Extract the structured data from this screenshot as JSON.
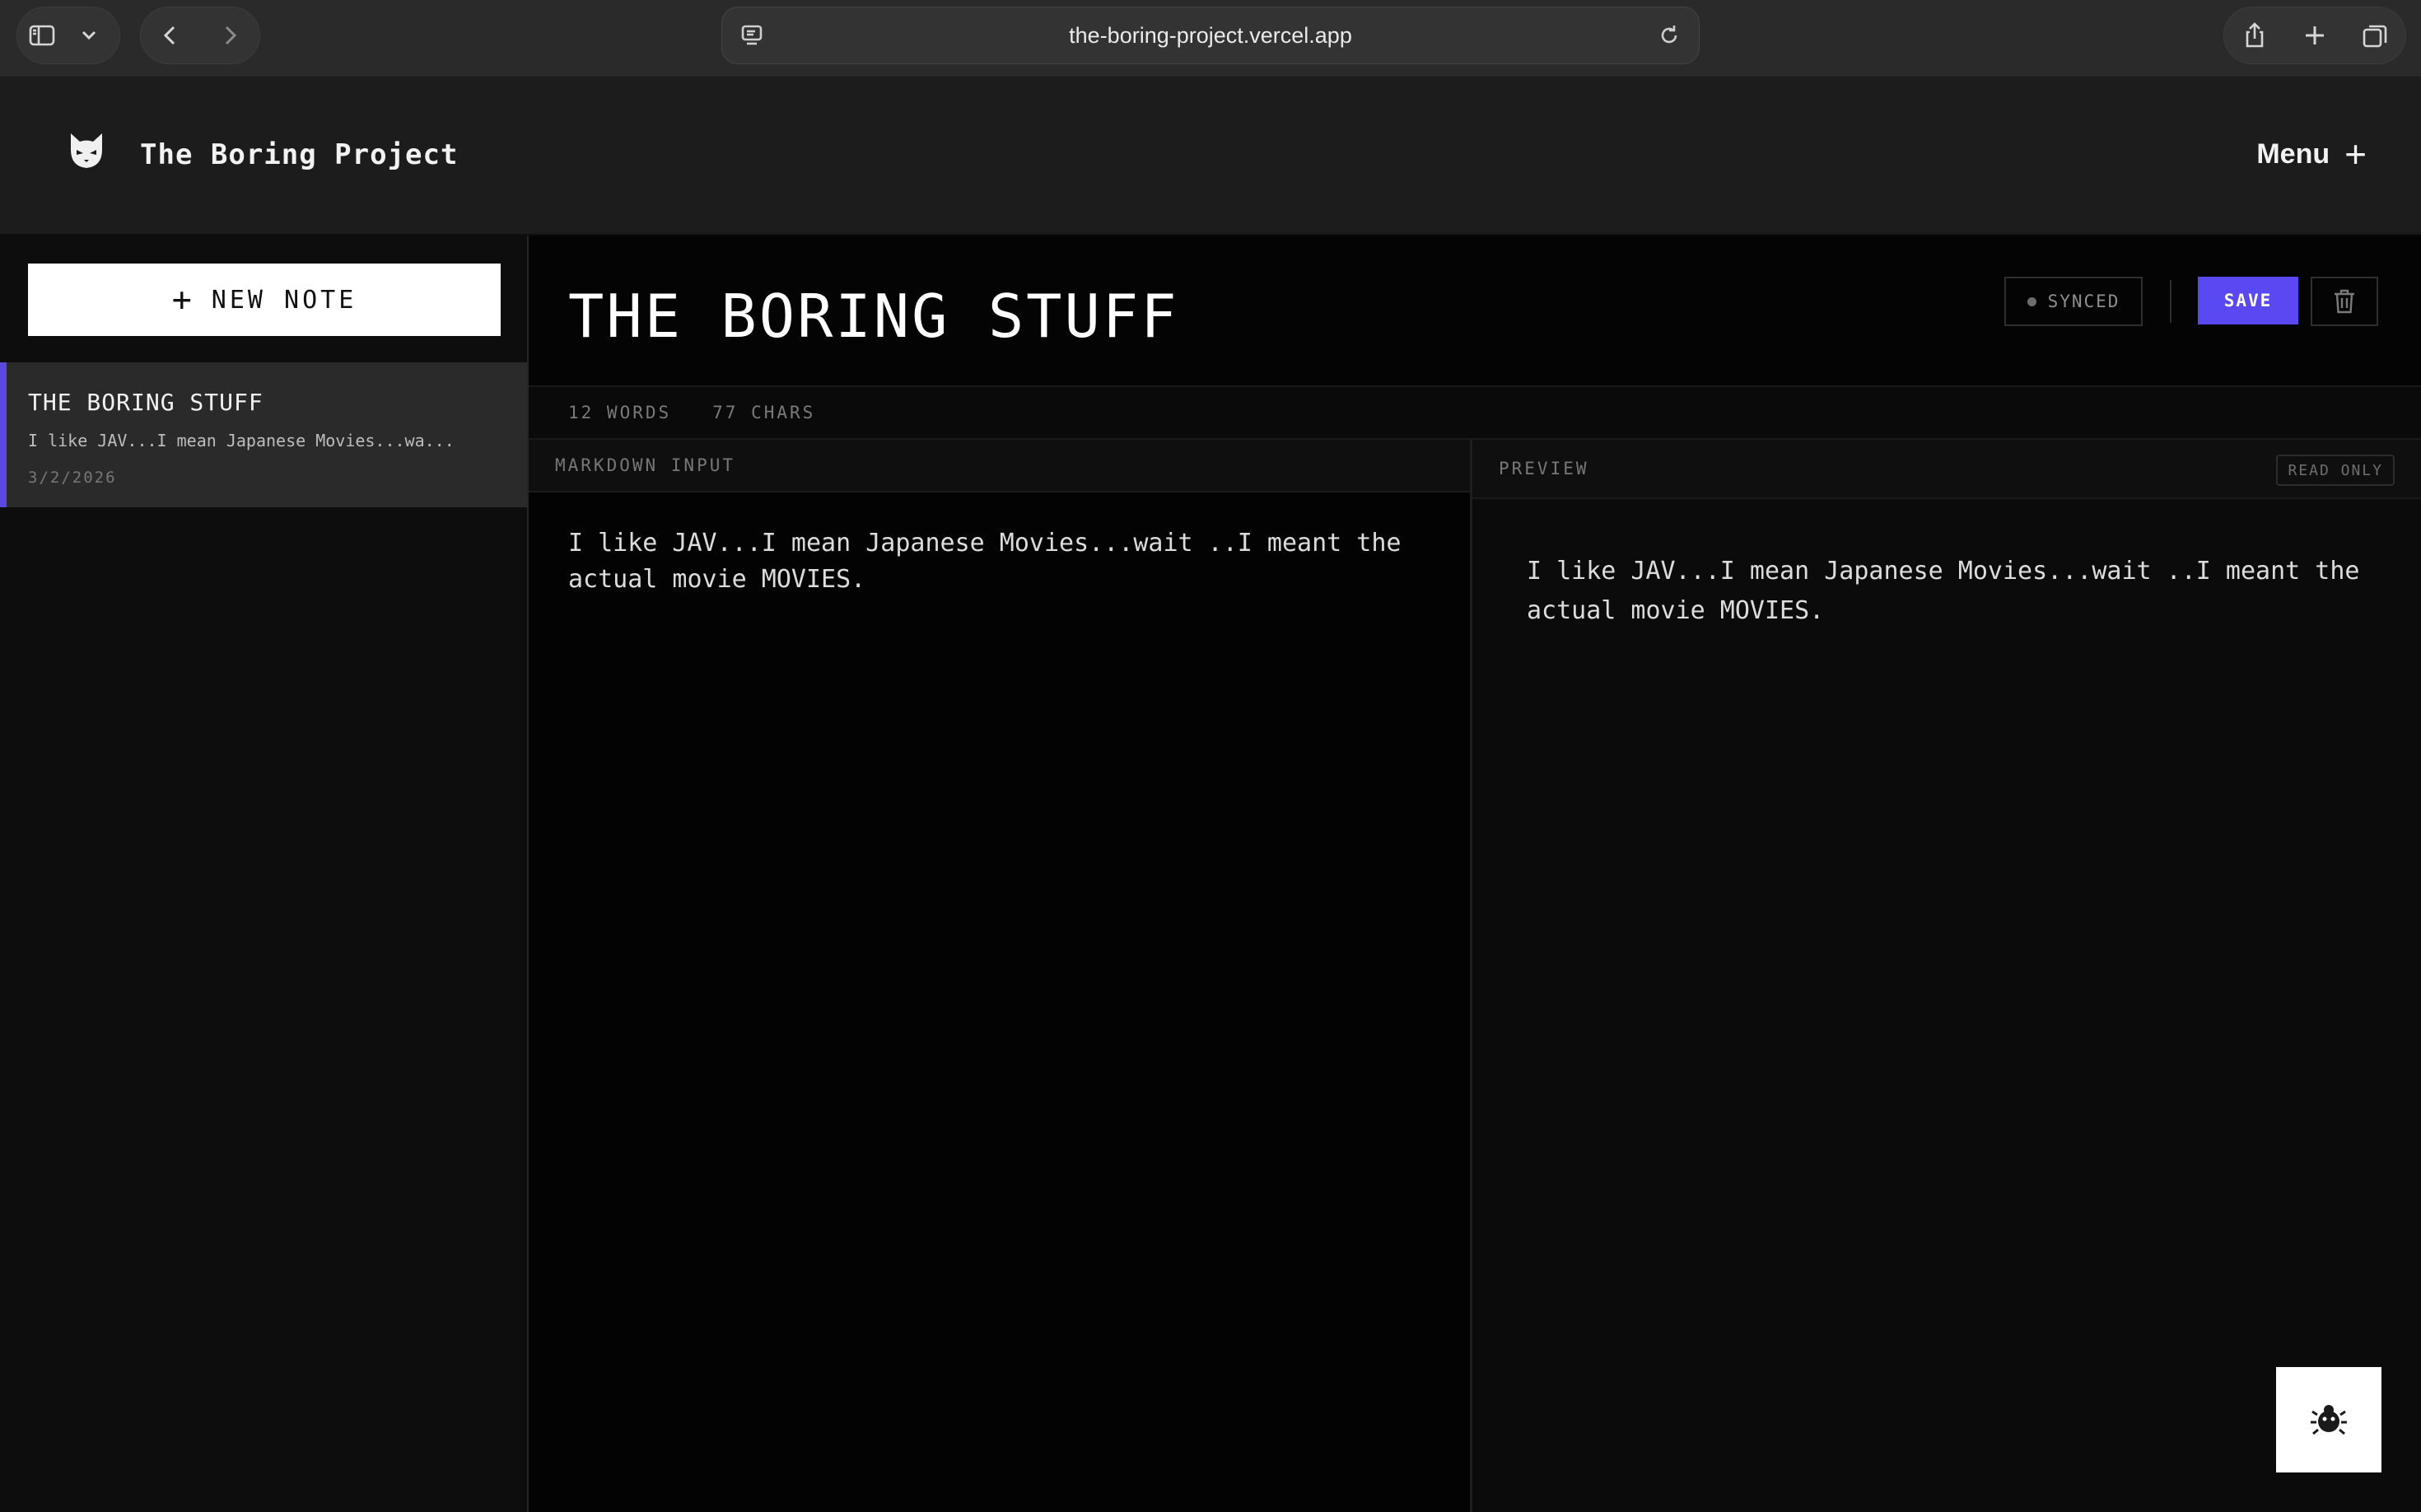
{
  "browser": {
    "url": "the-boring-project.vercel.app"
  },
  "app": {
    "title": "The Boring Project",
    "menu_label": "Menu",
    "accent_color": "#5a49f2"
  },
  "sidebar": {
    "new_note_label": "NEW NOTE",
    "notes": [
      {
        "title": "THE BORING STUFF",
        "preview": "I like JAV...I mean Japanese Movies...wa...",
        "date": "3/2/2026"
      }
    ]
  },
  "editor": {
    "title": "THE BORING STUFF",
    "status": "SYNCED",
    "save_label": "SAVE",
    "stats": {
      "words": "12 WORDS",
      "chars": "77 CHARS"
    },
    "markdown_header": "MARKDOWN INPUT",
    "markdown_value": "I like JAV...I mean Japanese Movies...wait ..I meant the actual movie MOVIES.",
    "preview_header": "PREVIEW",
    "read_only_label": "READ ONLY",
    "preview_text": "I like JAV...I mean Japanese Movies...wait ..I meant the actual movie MOVIES."
  },
  "icons": {
    "sidebar_toggle": "sidebar-icon",
    "back": "chevron-left-icon",
    "forward": "chevron-right-icon",
    "reload": "reload-icon",
    "share": "share-icon",
    "new_tab": "plus-icon",
    "tabs": "tabs-icon",
    "logo": "cat-logo-icon",
    "delete": "trash-icon",
    "widget": "bug-icon"
  }
}
